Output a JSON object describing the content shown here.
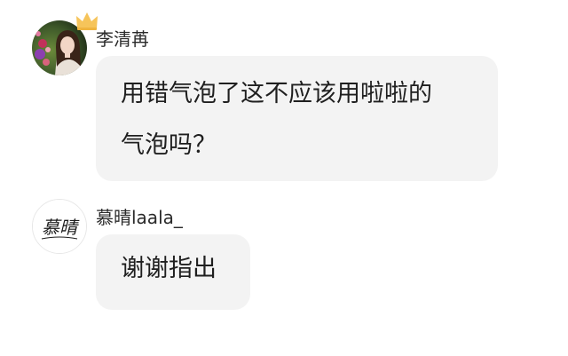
{
  "messages": [
    {
      "username": "李清苒",
      "avatar_icon": "user-photo-avatar",
      "badge_icon": "crown-icon",
      "badge_color": "#f6c45a",
      "lines": [
        "用错气泡了这不应该用啦啦的",
        "气泡吗？"
      ]
    },
    {
      "username": "慕晴laala_",
      "avatar_icon": "calligraphy-logo-avatar",
      "avatar_text": "慕晴",
      "lines": [
        "谢谢指出"
      ]
    }
  ],
  "colors": {
    "bubble": "#f3f3f3",
    "text": "#1f1f1f",
    "background": "#ffffff"
  }
}
